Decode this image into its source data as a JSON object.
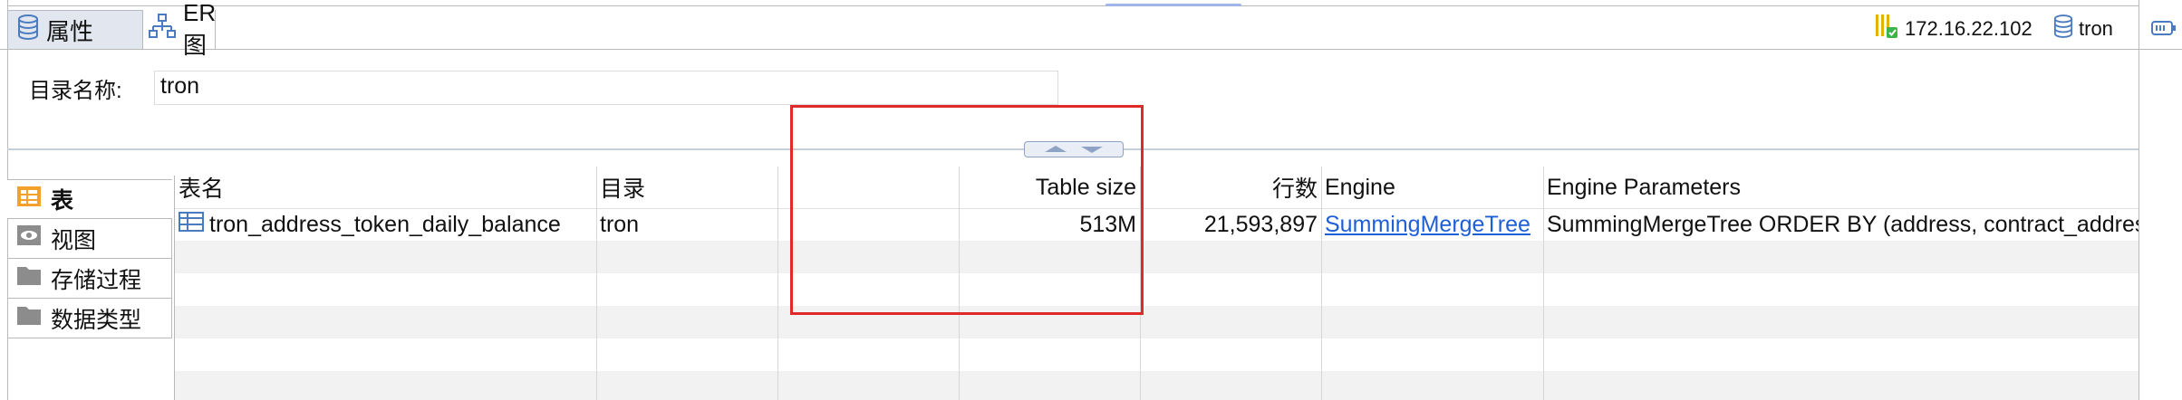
{
  "tabs": [
    {
      "label": "属性",
      "icon": "database-icon"
    },
    {
      "label": "ER 图",
      "icon": "er-diagram-icon"
    }
  ],
  "connection": {
    "host": "172.16.22.102",
    "database": "tron",
    "host_icon": "server-status-icon",
    "db_icon": "database-icon"
  },
  "form": {
    "dir_label": "目录名称:",
    "dir_value": "tron"
  },
  "nav": [
    {
      "label": "表",
      "icon": "table-folder-icon"
    },
    {
      "label": "视图",
      "icon": "view-eye-icon"
    },
    {
      "label": "存储过程",
      "icon": "folder-icon"
    },
    {
      "label": "数据类型",
      "icon": "folder-icon"
    }
  ],
  "table": {
    "headers": [
      "表名",
      "目录",
      "",
      "Table size",
      "行数",
      "Engine",
      "Engine Parameters"
    ],
    "rows": [
      {
        "name": "tron_address_token_daily_balance",
        "catalog": "tron",
        "size": "513M",
        "rows": "21,593,897",
        "engine": "SummingMergeTree",
        "params": "SummingMergeTree ORDER BY (address, contract_address, timestamp"
      }
    ]
  },
  "colors": {
    "accent": "#1e5fd8",
    "highlight": "#e02a2a",
    "selected_tab": "#e2e7ef"
  }
}
